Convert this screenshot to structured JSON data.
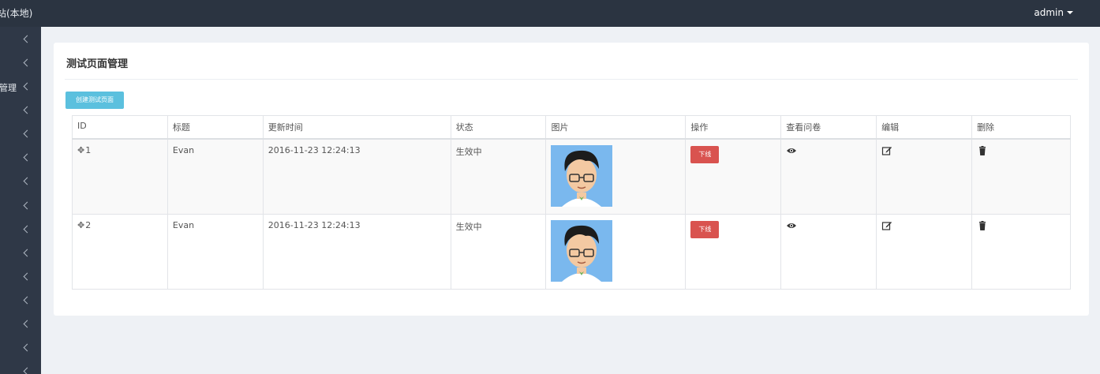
{
  "app": {
    "title": "站(本地)",
    "user": "admin"
  },
  "sidebar": {
    "items": [
      {
        "label": ""
      },
      {
        "label": ""
      },
      {
        "label": "管理"
      },
      {
        "label": ""
      },
      {
        "label": ""
      },
      {
        "label": ""
      },
      {
        "label": ""
      },
      {
        "label": ""
      },
      {
        "label": ""
      },
      {
        "label": ""
      },
      {
        "label": ""
      },
      {
        "label": ""
      },
      {
        "label": ""
      },
      {
        "label": ""
      },
      {
        "label": ""
      }
    ]
  },
  "page": {
    "title": "测试页面管理",
    "create_label": "创建测试页面",
    "table": {
      "columns": [
        "ID",
        "标题",
        "更新时间",
        "状态",
        "图片",
        "操作",
        "查看问卷",
        "编辑",
        "删除"
      ],
      "rows": [
        {
          "id": "1",
          "title": "Evan",
          "updated": "2016-11-23 12:24:13",
          "status": "生效中",
          "action": "下线"
        },
        {
          "id": "2",
          "title": "Evan",
          "updated": "2016-11-23 12:24:13",
          "status": "生效中",
          "action": "下线"
        }
      ]
    }
  },
  "colors": {
    "topbar": "#2b3441",
    "sidebar": "#2f3847",
    "create_button": "#5bc0de",
    "offline_button": "#d9534f"
  },
  "icons": {
    "move": "arrows-move-icon",
    "view": "eye-icon",
    "edit": "edit-icon",
    "delete": "trash-icon",
    "expand": "chevron-left-icon"
  }
}
